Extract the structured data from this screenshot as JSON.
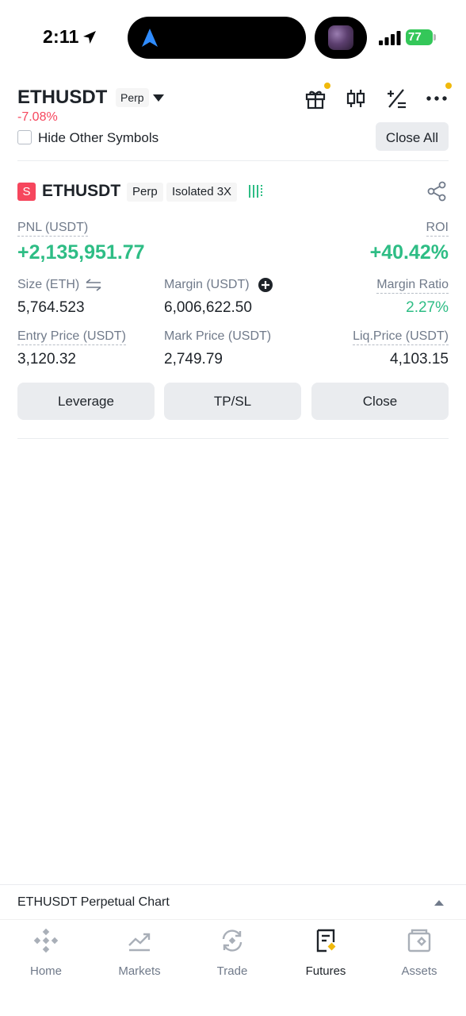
{
  "status_bar": {
    "time": "2:11",
    "battery": "77"
  },
  "header": {
    "symbol": "ETHUSDT",
    "contract_type": "Perp",
    "change": "-7.08%",
    "icons": [
      "gift-icon",
      "candlestick-icon",
      "calculator-icon",
      "more-icon"
    ]
  },
  "filter": {
    "hide_label": "Hide Other Symbols",
    "hide_checked": false,
    "close_all": "Close All"
  },
  "position": {
    "side": "S",
    "symbol": "ETHUSDT",
    "contract_type": "Perp",
    "margin_mode": "Isolated 3X",
    "pnl_label": "PNL (USDT)",
    "pnl_value": "+2,135,951.77",
    "roi_label": "ROI",
    "roi_value": "+40.42%",
    "size_label": "Size (ETH)",
    "size_value": "5,764.523",
    "margin_label": "Margin (USDT)",
    "margin_value": "6,006,622.50",
    "margin_ratio_label": "Margin Ratio",
    "margin_ratio_value": "2.27%",
    "entry_label": "Entry Price (USDT)",
    "entry_value": "3,120.32",
    "mark_label": "Mark Price (USDT)",
    "mark_value": "2,749.79",
    "liq_label": "Liq.Price (USDT)",
    "liq_value": "4,103.15",
    "buttons": {
      "leverage": "Leverage",
      "tpsl": "TP/SL",
      "close": "Close"
    }
  },
  "chart_bar": {
    "title": "ETHUSDT Perpetual Chart"
  },
  "nav": [
    {
      "label": "Home",
      "icon": "home-icon"
    },
    {
      "label": "Markets",
      "icon": "markets-icon"
    },
    {
      "label": "Trade",
      "icon": "trade-icon"
    },
    {
      "label": "Futures",
      "icon": "futures-icon",
      "active": true
    },
    {
      "label": "Assets",
      "icon": "assets-icon"
    }
  ],
  "colors": {
    "up": "#2ebd85",
    "down": "#f6465d",
    "accent": "#f0b90b",
    "text": "#1e2329",
    "muted": "#707a8a"
  }
}
